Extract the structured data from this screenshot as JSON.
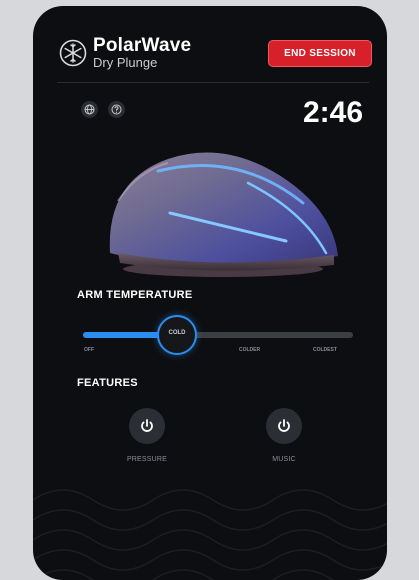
{
  "header": {
    "brand_name": "PolarWave",
    "brand_sub": "Dry Plunge",
    "end_session_label": "END SESSION"
  },
  "session": {
    "timer": "2:46"
  },
  "temperature": {
    "title": "ARM TEMPERATURE",
    "selected": "COLD",
    "level_fraction": 0.33,
    "ticks": [
      "OFF",
      "COLDER",
      "COLDEST"
    ]
  },
  "features": {
    "title": "FEATURES",
    "items": [
      {
        "label": "PRESSURE",
        "icon": "power-icon"
      },
      {
        "label": "MUSIC",
        "icon": "power-icon"
      }
    ]
  },
  "colors": {
    "background": "#0d0e11",
    "accent_blue": "#2a8ef0",
    "end_session_red": "#d7202a"
  }
}
